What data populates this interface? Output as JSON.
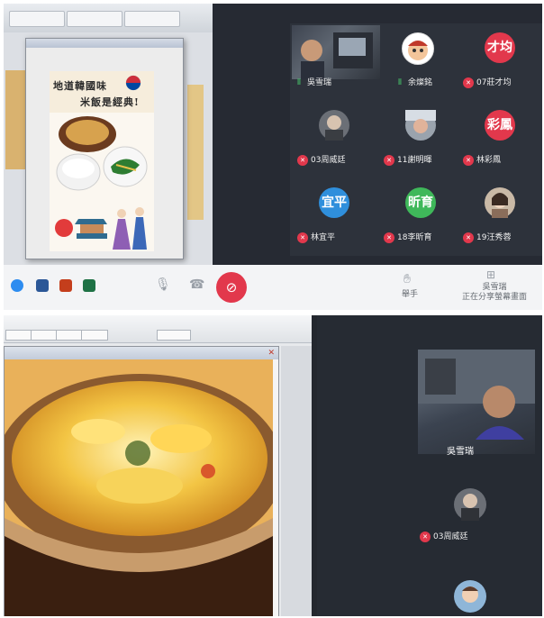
{
  "screenshot_top": {
    "poster": {
      "line1": "地道韓國味",
      "line2": "米飯是經典!"
    },
    "controls": {
      "raise_hand_label": "舉手",
      "share_owner": "吳雪瑞",
      "share_status": "正在分享螢幕畫面"
    },
    "participants": [
      {
        "name": "吳雪瑞",
        "mic": "on",
        "video": true
      },
      {
        "name": "余燦銘",
        "mic": "on",
        "avatar_color": "#d98b4a"
      },
      {
        "name": "07莊才均",
        "mic": "muted",
        "avatar_text": "才均",
        "avatar_color": "#e2384c"
      },
      {
        "name": "03周威廷",
        "mic": "muted",
        "avatar_color": "#6b6f76"
      },
      {
        "name": "11謝明暉",
        "mic": "muted",
        "avatar_color": "#9aa3ad"
      },
      {
        "name": "林彩鳳",
        "mic": "muted",
        "avatar_text": "彩鳳",
        "avatar_color": "#e2384c"
      },
      {
        "name": "林宜平",
        "mic": "muted",
        "avatar_text": "宜平",
        "avatar_color": "#2f8fdc"
      },
      {
        "name": "18李昕育",
        "mic": "muted",
        "avatar_text": "昕育",
        "avatar_color": "#3fb85a"
      },
      {
        "name": "19汪秀蓉",
        "mic": "muted",
        "avatar_color": "#c9b9a6"
      }
    ]
  },
  "screenshot_bottom": {
    "participants": [
      {
        "name": "吳雪瑞",
        "video": true
      },
      {
        "name": "03周威廷",
        "mic": "muted",
        "avatar_color": "#6b6f76"
      },
      {
        "name": "",
        "avatar_color": "#8fb6d8"
      }
    ]
  },
  "colors": {
    "accent_red": "#e2384c",
    "meeting_bg": "#2d323b"
  }
}
